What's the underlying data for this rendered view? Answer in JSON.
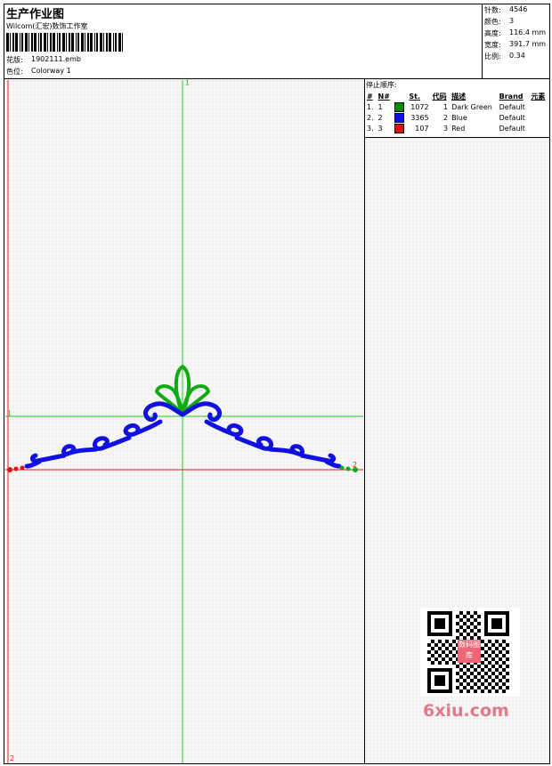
{
  "header": {
    "title": "生产作业图",
    "company": "Wilcom(汇宏)数饰工作室",
    "design_label": "花版:",
    "design_value": "1902111.emb",
    "colorway_label": "色位:",
    "colorway_value": "Colorway 1"
  },
  "stats": {
    "stitches_label": "针数:",
    "stitches_value": "4546",
    "colors_label": "颜色:",
    "colors_value": "3",
    "height_label": "高度:",
    "height_value": "116.4 mm",
    "width_label": "宽度:",
    "width_value": "391.7 mm",
    "scale_label": "比例:",
    "scale_value": "0.34"
  },
  "stop_sequence": {
    "title": "停止顺序:",
    "columns": [
      "#",
      "N#",
      "St.",
      "代码",
      "描述",
      "Brand",
      "元素"
    ],
    "rows": [
      {
        "idx": "1.",
        "n": "1",
        "stitches": "1072",
        "code": "1",
        "desc": "Dark Green",
        "brand": "Default",
        "color": "#0a8a0a"
      },
      {
        "idx": "2.",
        "n": "2",
        "stitches": "3365",
        "code": "2",
        "desc": "Blue",
        "brand": "Default",
        "color": "#1010e0"
      },
      {
        "idx": "3.",
        "n": "3",
        "stitches": "107",
        "code": "3",
        "desc": "Red",
        "brand": "Default",
        "color": "#e01010"
      }
    ]
  },
  "markers": {
    "top": "1",
    "left_mid": "1",
    "right": "2",
    "bottom_left": "2"
  },
  "watermark": {
    "text": "6xiu.com",
    "stamp": "数码图库"
  },
  "colors": {
    "green": "#11aa11",
    "blue": "#1010e0",
    "red": "#dd1111",
    "guide_green": "#22cc22",
    "guide_red": "#ee2222"
  }
}
